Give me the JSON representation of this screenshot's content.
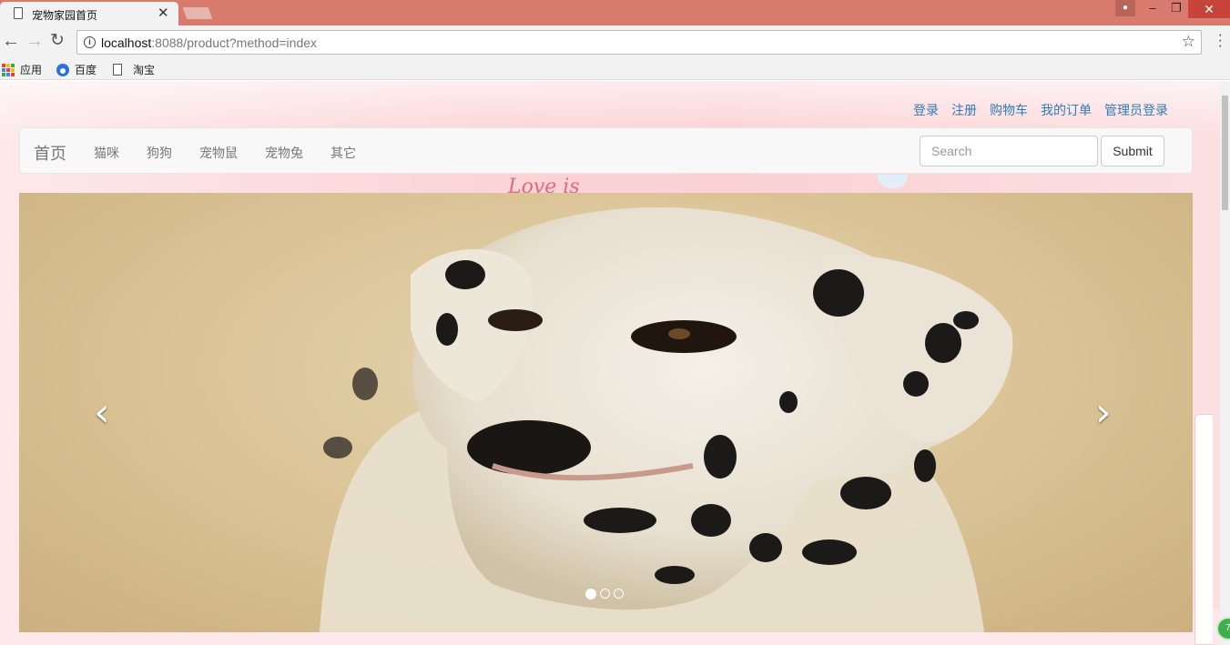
{
  "browser": {
    "tab_title": "宠物家园首页",
    "url_host": "localhost",
    "url_rest": ":8088/product?method=index",
    "bookmarks": [
      "应用",
      "百度",
      "淘宝"
    ]
  },
  "header": {
    "links": [
      "登录",
      "注册",
      "购物车",
      "我的订单",
      "管理员登录"
    ]
  },
  "navbar": {
    "brand": "首页",
    "items": [
      "猫咪",
      "狗狗",
      "宠物鼠",
      "宠物兔",
      "其它"
    ],
    "search_placeholder": "Search",
    "submit_label": "Submit"
  },
  "decoration": {
    "script_text": "Love is"
  },
  "carousel": {
    "slide_count": 3,
    "active_index": 0,
    "prev_icon": "chevron-left-icon",
    "next_icon": "chevron-right-icon"
  },
  "colors": {
    "tabstrip": "#d87a6e",
    "link": "#337ab7",
    "page_bg": "#fbd4d7"
  }
}
